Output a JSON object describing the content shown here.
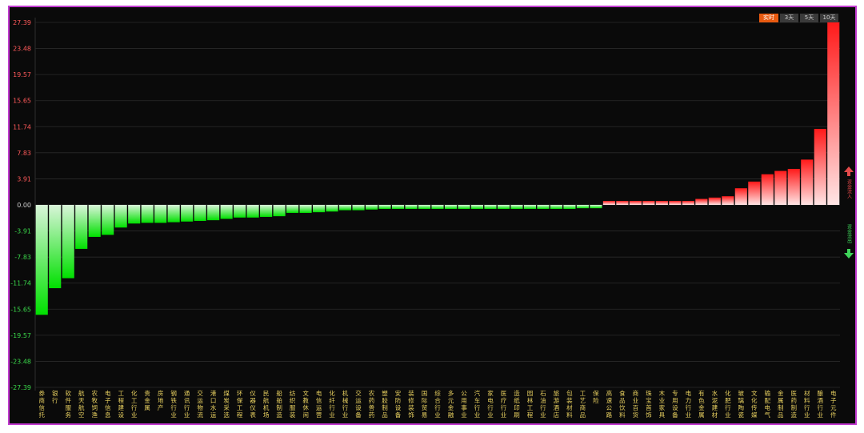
{
  "tabs": [
    "实时",
    "3天",
    "5天",
    "10天"
  ],
  "active_tab": "实时",
  "inflow_label": "资金流入",
  "outflow_label": "资金流出",
  "chart_data": {
    "type": "bar",
    "yticks": [
      "27.39",
      "23.48",
      "19.57",
      "15.65",
      "11.74",
      "7.83",
      "3.91",
      "0.00",
      "-3.91",
      "-7.83",
      "-11.74",
      "-15.65",
      "-19.57",
      "-23.48",
      "-27.39"
    ],
    "ylim": [
      -27.39,
      27.39
    ],
    "categories": [
      "券商信托",
      "银行",
      "软件服务",
      "航天航空",
      "农牧饲渔",
      "电子信息",
      "工程建设",
      "化工行业",
      "贵金属",
      "房地产",
      "钢铁行业",
      "通讯行业",
      "交运物流",
      "港口水运",
      "煤炭采选",
      "环保工程",
      "仪器仪表",
      "民航机场",
      "船舶制造",
      "纺织服装",
      "文教休闲",
      "电信运营",
      "化纤行业",
      "机械行业",
      "交运设备",
      "农药兽药",
      "塑胶制品",
      "安防设备",
      "装修装饰",
      "国际贸易",
      "综合行业",
      "多元金融",
      "公用事业",
      "汽车行业",
      "家电行业",
      "医疗行业",
      "造纸印刷",
      "园林工程",
      "石油行业",
      "旅游酒店",
      "包装材料",
      "工艺商品",
      "保险",
      "高速公路",
      "食品饮料",
      "商业百货",
      "珠宝首饰",
      "木业家具",
      "专用设备",
      "电力行业",
      "有色金属",
      "水泥建材",
      "化肥行业",
      "玻璃陶瓷",
      "文化传媒",
      "输配电气",
      "金属制品",
      "医药制造",
      "材料行业",
      "酿酒行业",
      "电子元件"
    ],
    "values": [
      -16.5,
      -12.5,
      -11.0,
      -6.6,
      -4.8,
      -4.5,
      -3.4,
      -2.8,
      -2.7,
      -2.7,
      -2.6,
      -2.5,
      -2.4,
      -2.3,
      -2.1,
      -1.9,
      -1.9,
      -1.8,
      -1.7,
      -1.2,
      -1.2,
      -1.1,
      -1.0,
      -0.8,
      -0.8,
      -0.7,
      -0.6,
      -0.6,
      -0.6,
      -0.6,
      -0.6,
      -0.6,
      -0.6,
      -0.6,
      -0.6,
      -0.6,
      -0.6,
      -0.6,
      -0.6,
      -0.6,
      -0.6,
      -0.5,
      -0.5,
      0.6,
      0.6,
      0.6,
      0.6,
      0.6,
      0.6,
      0.6,
      0.9,
      1.1,
      1.3,
      2.5,
      3.5,
      4.6,
      5.1,
      5.4,
      6.8,
      11.4,
      27.4
    ],
    "colors": {
      "pos_top": "#ff1a1a",
      "pos_bottom": "#ffe5e5",
      "neg_top": "#d9f5d9",
      "neg_bottom": "#00e000",
      "grid": "#2a2a2a",
      "axis": "#2f2f2f",
      "pos_label": "#ff5a5a",
      "neg_label": "#3ad84a",
      "zero_label": "#cfcfcf",
      "category_label": "#e8d060"
    }
  }
}
